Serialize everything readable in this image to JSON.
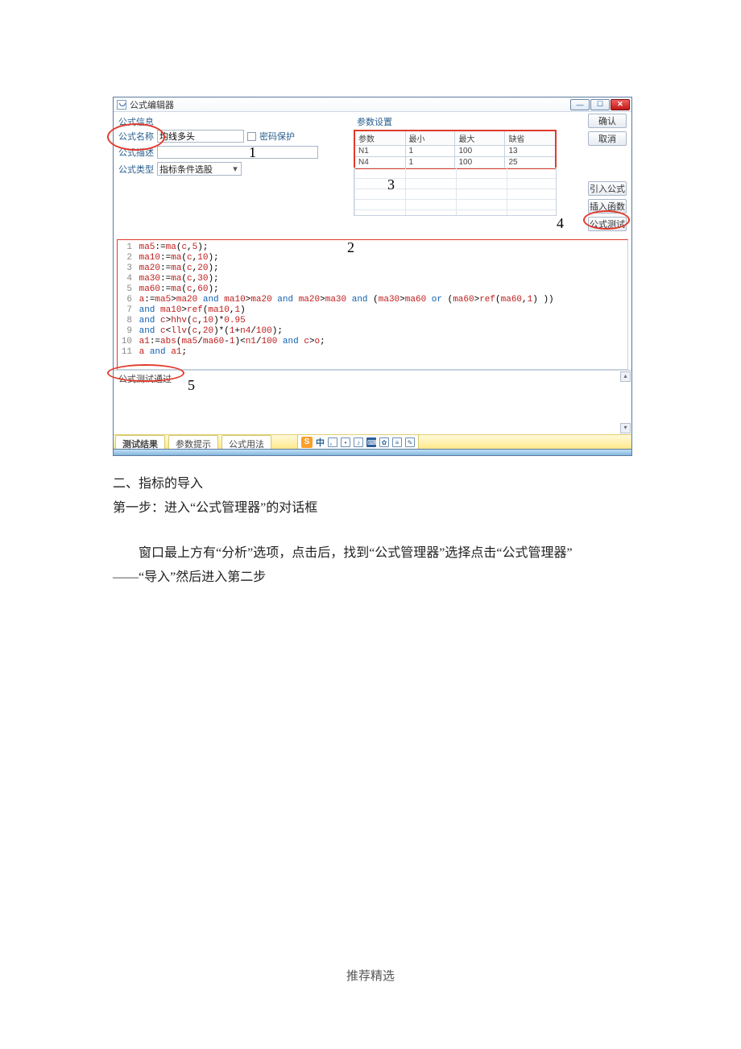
{
  "window": {
    "title": "公式编辑器",
    "sections": {
      "formula_info": "公式信息",
      "param_cfg": "参数设置"
    },
    "labels": {
      "name": "公式名称",
      "pwd": "密码保护",
      "desc": "公式描述",
      "type": "公式类型"
    },
    "fields": {
      "name_value": "均线多头",
      "desc_value": "",
      "type_value": "指标条件选股"
    },
    "buttons": {
      "ok": "确认",
      "cancel": "取消",
      "import_formula": "引入公式",
      "insert_func": "插入函数",
      "test": "公式测试"
    },
    "params": {
      "headers": [
        "参数",
        "最小",
        "最大",
        "缺省"
      ],
      "rows": [
        [
          "N1",
          "1",
          "100",
          "13"
        ],
        [
          "N4",
          "1",
          "100",
          "25"
        ]
      ]
    },
    "code_lines": [
      [
        {
          "ln": "1"
        },
        {
          "id": "ma5"
        },
        {
          "pl": ":="
        },
        {
          "fn": "ma"
        },
        {
          "pl": "("
        },
        {
          "id": "c"
        },
        {
          "pl": ","
        },
        {
          "num": "5"
        },
        {
          "pl": ");"
        }
      ],
      [
        {
          "ln": "2"
        },
        {
          "id": "ma10"
        },
        {
          "pl": ":="
        },
        {
          "fn": "ma"
        },
        {
          "pl": "("
        },
        {
          "id": "c"
        },
        {
          "pl": ","
        },
        {
          "num": "10"
        },
        {
          "pl": ");"
        }
      ],
      [
        {
          "ln": "3"
        },
        {
          "id": "ma20"
        },
        {
          "pl": ":="
        },
        {
          "fn": "ma"
        },
        {
          "pl": "("
        },
        {
          "id": "c"
        },
        {
          "pl": ","
        },
        {
          "num": "20"
        },
        {
          "pl": ");"
        }
      ],
      [
        {
          "ln": "4"
        },
        {
          "id": "ma30"
        },
        {
          "pl": ":="
        },
        {
          "fn": "ma"
        },
        {
          "pl": "("
        },
        {
          "id": "c"
        },
        {
          "pl": ","
        },
        {
          "num": "30"
        },
        {
          "pl": ");"
        }
      ],
      [
        {
          "ln": "5"
        },
        {
          "id": "ma60"
        },
        {
          "pl": ":="
        },
        {
          "fn": "ma"
        },
        {
          "pl": "("
        },
        {
          "id": "c"
        },
        {
          "pl": ","
        },
        {
          "num": "60"
        },
        {
          "pl": ");"
        }
      ],
      [
        {
          "ln": "6"
        },
        {
          "id": "a"
        },
        {
          "pl": ":="
        },
        {
          "id": "ma5"
        },
        {
          "pl": ">"
        },
        {
          "id": "ma20"
        },
        {
          "kw": " and "
        },
        {
          "id": "ma10"
        },
        {
          "pl": ">"
        },
        {
          "id": "ma20"
        },
        {
          "kw": " and "
        },
        {
          "id": "ma20"
        },
        {
          "pl": ">"
        },
        {
          "id": "ma30"
        },
        {
          "kw": " and "
        },
        {
          "pl": "("
        },
        {
          "id": "ma30"
        },
        {
          "pl": ">"
        },
        {
          "id": "ma60"
        },
        {
          "kw": " or "
        },
        {
          "pl": "("
        },
        {
          "id": "ma60"
        },
        {
          "pl": ">"
        },
        {
          "fn": "ref"
        },
        {
          "pl": "("
        },
        {
          "id": "ma60"
        },
        {
          "pl": ","
        },
        {
          "num": "1"
        },
        {
          "pl": ") ))"
        }
      ],
      [
        {
          "ln": "7"
        },
        {
          "kw": "and "
        },
        {
          "id": "ma10"
        },
        {
          "pl": ">"
        },
        {
          "fn": "ref"
        },
        {
          "pl": "("
        },
        {
          "id": "ma10"
        },
        {
          "pl": ","
        },
        {
          "num": "1"
        },
        {
          "pl": ")"
        }
      ],
      [
        {
          "ln": "8"
        },
        {
          "kw": "and "
        },
        {
          "id": "c"
        },
        {
          "pl": ">"
        },
        {
          "fn": "hhv"
        },
        {
          "pl": "("
        },
        {
          "id": "c"
        },
        {
          "pl": ","
        },
        {
          "num": "10"
        },
        {
          "pl": ")*"
        },
        {
          "num": "0.95"
        }
      ],
      [
        {
          "ln": "9"
        },
        {
          "kw": "and "
        },
        {
          "id": "c"
        },
        {
          "pl": "<"
        },
        {
          "fn": "llv"
        },
        {
          "pl": "("
        },
        {
          "id": "c"
        },
        {
          "pl": ","
        },
        {
          "num": "20"
        },
        {
          "pl": ")*("
        },
        {
          "num": "1"
        },
        {
          "pl": "+"
        },
        {
          "id": "n4"
        },
        {
          "pl": "/"
        },
        {
          "num": "100"
        },
        {
          "pl": ");"
        }
      ],
      [
        {
          "ln": "10"
        },
        {
          "id": "a1"
        },
        {
          "pl": ":="
        },
        {
          "fn": "abs"
        },
        {
          "pl": "("
        },
        {
          "id": "ma5"
        },
        {
          "pl": "/"
        },
        {
          "id": "ma60"
        },
        {
          "pl": "-"
        },
        {
          "num": "1"
        },
        {
          "pl": ")<"
        },
        {
          "id": "n1"
        },
        {
          "pl": "/"
        },
        {
          "num": "100"
        },
        {
          "kw": " and "
        },
        {
          "id": "c"
        },
        {
          "pl": ">"
        },
        {
          "id": "o"
        },
        {
          "pl": ";"
        }
      ],
      [
        {
          "ln": "11"
        },
        {
          "id": "a"
        },
        {
          "kw": " and "
        },
        {
          "id": "a1"
        },
        {
          "pl": ";"
        }
      ]
    ],
    "status_text": "公式测试通过",
    "tabs": {
      "result": "测试结果",
      "hint": "参数提示",
      "usage": "公式用法"
    },
    "ime": {
      "cntext": "中"
    }
  },
  "annotations": {
    "n1": "1",
    "n2": "2",
    "n3": "3",
    "n4": "4",
    "n5": "5"
  },
  "doc": {
    "h": "二、指标的导入",
    "s1": "第一步：进入“公式管理器”的对话框",
    "p2": "窗口最上方有“分析”选项，点击后，找到“公式管理器”选择点击“公式管理器”",
    "p3": "——“导入”然后进入第二步"
  },
  "footer": "推荐精选"
}
